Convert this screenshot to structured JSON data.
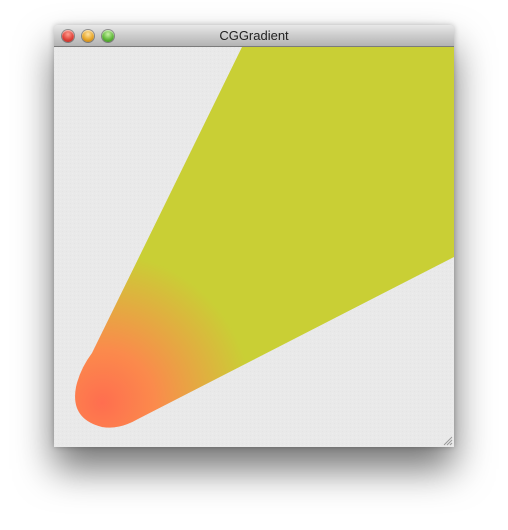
{
  "window": {
    "title": "CGGradient",
    "controls": [
      "close",
      "minimize",
      "zoom"
    ]
  },
  "canvas": {
    "background": "#e9e9e9",
    "gradient": {
      "type": "radial",
      "start_color": "#ff6e4f",
      "end_color": "#c9cf35"
    }
  },
  "icons": {
    "close": "close-button-icon",
    "minimize": "minimize-button-icon",
    "zoom": "zoom-button-icon",
    "resize": "resize-grip-icon"
  }
}
